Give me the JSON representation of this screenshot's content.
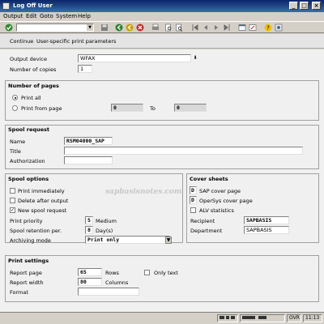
{
  "window": {
    "title": "Log Off User"
  },
  "menu": [
    "Output",
    "Edit",
    "Goto",
    "System",
    "Help"
  ],
  "app_toolbar": {
    "continue": "Continue",
    "user_params": "User-specific print parameters"
  },
  "output": {
    "device_label": "Output device",
    "device_value": "WFAX",
    "copies_label": "Number of copies",
    "copies_value": "1"
  },
  "pages": {
    "title": "Number of pages",
    "print_all": "Print all",
    "print_from": "Print from page",
    "from_value": "0",
    "to_label": "To",
    "to_value": "0"
  },
  "spool_request": {
    "title": "Spool request",
    "name_label": "Name",
    "name_value": "RSM04000_SAP",
    "title_label": "Title",
    "title_value": "",
    "auth_label": "Authorization",
    "auth_value": ""
  },
  "spool_options": {
    "title": "Spool options",
    "print_immediately": "Print immediately",
    "delete_after": "Delete after output",
    "new_spool": "New spool request",
    "priority_label": "Print priority",
    "priority_value": "5",
    "priority_text": "Medium",
    "retention_label": "Spool retention per.",
    "retention_value": "8",
    "retention_unit": "Day(s)",
    "archiving_label": "Archiving mode",
    "archiving_value": "Print only"
  },
  "cover_sheets": {
    "title": "Cover sheets",
    "sap_cover_value": "D",
    "sap_cover_label": "SAP cover page",
    "opersys_value": "D",
    "opersys_label": "OperSys cover page",
    "alv_label": "ALV statistics",
    "recipient_label": "Recipient",
    "recipient_value": "SAPBASIS",
    "department_label": "Department",
    "department_value": "SAPBASIS"
  },
  "print_settings": {
    "title": "Print settings",
    "report_page_label": "Report page",
    "report_page_value": "65",
    "rows_label": "Rows",
    "only_text_label": "Only text",
    "report_width_label": "Report width",
    "report_width_value": "80",
    "columns_label": "Columns",
    "format_label": "Format",
    "format_value": ""
  },
  "watermark": "sapbasisnotes.com",
  "status": {
    "mode": "OVR",
    "time": "11:13"
  }
}
